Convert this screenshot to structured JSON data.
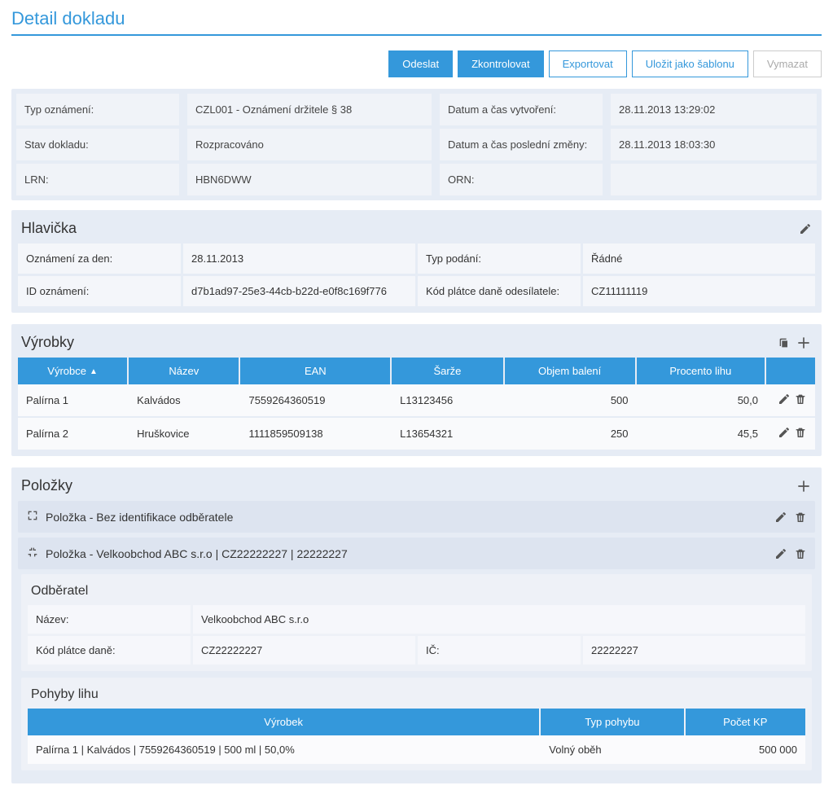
{
  "page_title": "Detail dokladu",
  "actions": {
    "send": "Odeslat",
    "check": "Zkontrolovat",
    "export": "Exportovat",
    "save_template": "Uložit jako šablonu",
    "clear": "Vymazat"
  },
  "summary": {
    "labels": {
      "type": "Typ oznámení:",
      "status": "Stav dokladu:",
      "lrn": "LRN:",
      "created": "Datum a čas vytvoření:",
      "modified": "Datum a čas poslední změny:",
      "orn": "ORN:"
    },
    "values": {
      "type": "CZL001 - Oznámení držitele § 38",
      "status": "Rozpracováno",
      "lrn": "HBN6DWW",
      "created": "28.11.2013 13:29:02",
      "modified": "28.11.2013 18:03:30",
      "orn": ""
    }
  },
  "header_section": {
    "title": "Hlavička",
    "labels": {
      "for_day": "Oznámení za den:",
      "id": "ID oznámení:",
      "submission_type": "Typ podání:",
      "sender_tax_code": "Kód plátce daně odesílatele:"
    },
    "values": {
      "for_day": "28.11.2013",
      "id": "d7b1ad97-25e3-44cb-b22d-e0f8c169f776",
      "submission_type": "Řádné",
      "sender_tax_code": "CZ11111119"
    }
  },
  "products": {
    "title": "Výrobky",
    "columns": {
      "maker": "Výrobce",
      "name": "Název",
      "ean": "EAN",
      "batch": "Šarže",
      "volume": "Objem balení",
      "alcohol": "Procento lihu"
    },
    "rows": [
      {
        "maker": "Palírna 1",
        "name": "Kalvádos",
        "ean": "7559264360519",
        "batch": "L13123456",
        "volume": "500",
        "alcohol": "50,0"
      },
      {
        "maker": "Palírna 2",
        "name": "Hruškovice",
        "ean": "1111859509138",
        "batch": "L13654321",
        "volume": "250",
        "alcohol": "45,5"
      }
    ]
  },
  "items": {
    "title": "Položky",
    "row1_title": "Položka - Bez identifikace odběratele",
    "row2_title": "Položka - Velkoobchod ABC s.r.o | CZ22222227 | 22222227",
    "customer": {
      "title": "Odběratel",
      "labels": {
        "name": "Název:",
        "tax_code": "Kód plátce daně:",
        "ic": "IČ:"
      },
      "values": {
        "name": "Velkoobchod ABC s.r.o",
        "tax_code": "CZ22222227",
        "ic": "22222227"
      }
    },
    "moves": {
      "title": "Pohyby lihu",
      "columns": {
        "product": "Výrobek",
        "move_type": "Typ pohybu",
        "kp_count": "Počet KP"
      },
      "rows": [
        {
          "product": "Palírna 1 | Kalvádos | 7559264360519 | 500 ml | 50,0%",
          "move_type": "Volný oběh",
          "kp_count": "500 000"
        }
      ]
    }
  }
}
